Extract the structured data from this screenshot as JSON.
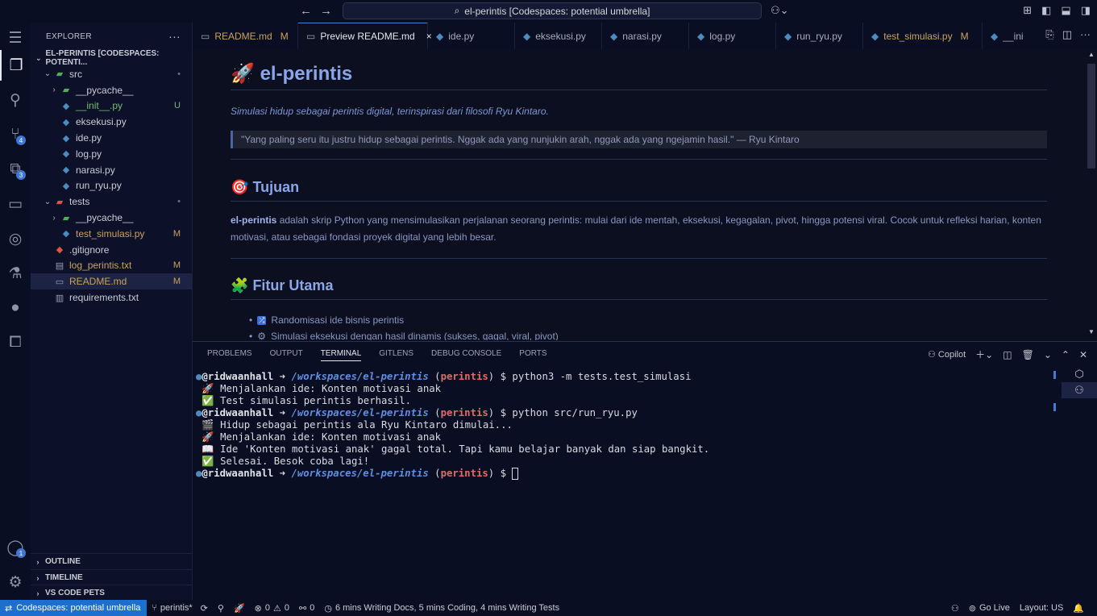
{
  "titlebar": {
    "command_center": "el-perintis [Codespaces: potential umbrella]"
  },
  "sidebar": {
    "title": "EXPLORER",
    "root": "EL-PERINTIS [CODESPACES: POTENTI...",
    "items": [
      {
        "label": "src",
        "status": "•"
      },
      {
        "label": "__pycache__",
        "status": ""
      },
      {
        "label": "__init__.py",
        "status": "U"
      },
      {
        "label": "eksekusi.py",
        "status": ""
      },
      {
        "label": "ide.py",
        "status": ""
      },
      {
        "label": "log.py",
        "status": ""
      },
      {
        "label": "narasi.py",
        "status": ""
      },
      {
        "label": "run_ryu.py",
        "status": ""
      },
      {
        "label": "tests",
        "status": "•"
      },
      {
        "label": "__pycache__",
        "status": ""
      },
      {
        "label": "test_simulasi.py",
        "status": "M"
      },
      {
        "label": ".gitignore",
        "status": ""
      },
      {
        "label": "log_perintis.txt",
        "status": "M"
      },
      {
        "label": "README.md",
        "status": "M"
      },
      {
        "label": "requirements.txt",
        "status": ""
      }
    ],
    "sections": [
      "OUTLINE",
      "TIMELINE",
      "VS CODE PETS"
    ]
  },
  "activity_badges": {
    "source_control": "4",
    "extensions": "3",
    "accounts": "1"
  },
  "tabs": [
    {
      "label": "README.md",
      "flag": "M"
    },
    {
      "label": "Preview README.md",
      "flag": ""
    },
    {
      "label": "ide.py",
      "flag": ""
    },
    {
      "label": "eksekusi.py",
      "flag": ""
    },
    {
      "label": "narasi.py",
      "flag": ""
    },
    {
      "label": "log.py",
      "flag": ""
    },
    {
      "label": "run_ryu.py",
      "flag": ""
    },
    {
      "label": "test_simulasi.py",
      "flag": "M"
    },
    {
      "label": "__ini",
      "flag": ""
    }
  ],
  "preview": {
    "title": "el-perintis",
    "tagline": "Simulasi hidup sebagai perintis digital, terinspirasi dari filosofi Ryu Kintaro.",
    "quote": "\"Yang paling seru itu justru hidup sebagai perintis. Nggak ada yang nunjukin arah, nggak ada yang ngejamin hasil.\" — Ryu Kintaro",
    "tujuan_heading": "Tujuan",
    "tujuan_bold": "el-perintis",
    "tujuan_text": " adalah skrip Python yang mensimulasikan perjalanan seorang perintis: mulai dari ide mentah, eksekusi, kegagalan, pivot, hingga potensi viral. Cocok untuk refleksi harian, konten motivasi, atau sebagai fondasi proyek digital yang lebih besar.",
    "fitur_heading": "Fitur Utama",
    "fitur": [
      "Randomisasi ide bisnis perintis",
      "Simulasi eksekusi dengan hasil dinamis (sukses, gagal, viral, pivot)"
    ]
  },
  "panel": {
    "tabs": [
      "PROBLEMS",
      "OUTPUT",
      "TERMINAL",
      "GITLENS",
      "DEBUG CONSOLE",
      "PORTS"
    ],
    "copilot_label": "Copilot"
  },
  "terminal": {
    "user": "@ridwaanhall",
    "arrow": " ➜ ",
    "path": "/workspaces/el-perintis",
    "branch": "perintis",
    "cmd1": "python3 -m tests.test_simulasi",
    "out1": "🚀 Menjalankan ide: Konten motivasi anak",
    "out2": "✅ Test simulasi perintis berhasil.",
    "cmd2": "python src/run_ryu.py",
    "out3": "🎬 Hidup sebagai perintis ala Ryu Kintaro dimulai...",
    "out4": "🚀 Menjalankan ide: Konten motivasi anak",
    "out5": "📖 Ide 'Konten motivasi anak' gagal total. Tapi kamu belajar banyak dan siap bangkit.",
    "out6": "✅ Selesai. Besok coba lagi!"
  },
  "statusbar": {
    "remote": "Codespaces: potential umbrella",
    "branch": "perintis*",
    "errors": "0",
    "warnings": "0",
    "ports": "0",
    "wakatime": "6 mins Writing Docs, 5 mins Coding, 4 mins Writing Tests",
    "golive": "Go Live",
    "layout": "Layout: US"
  }
}
